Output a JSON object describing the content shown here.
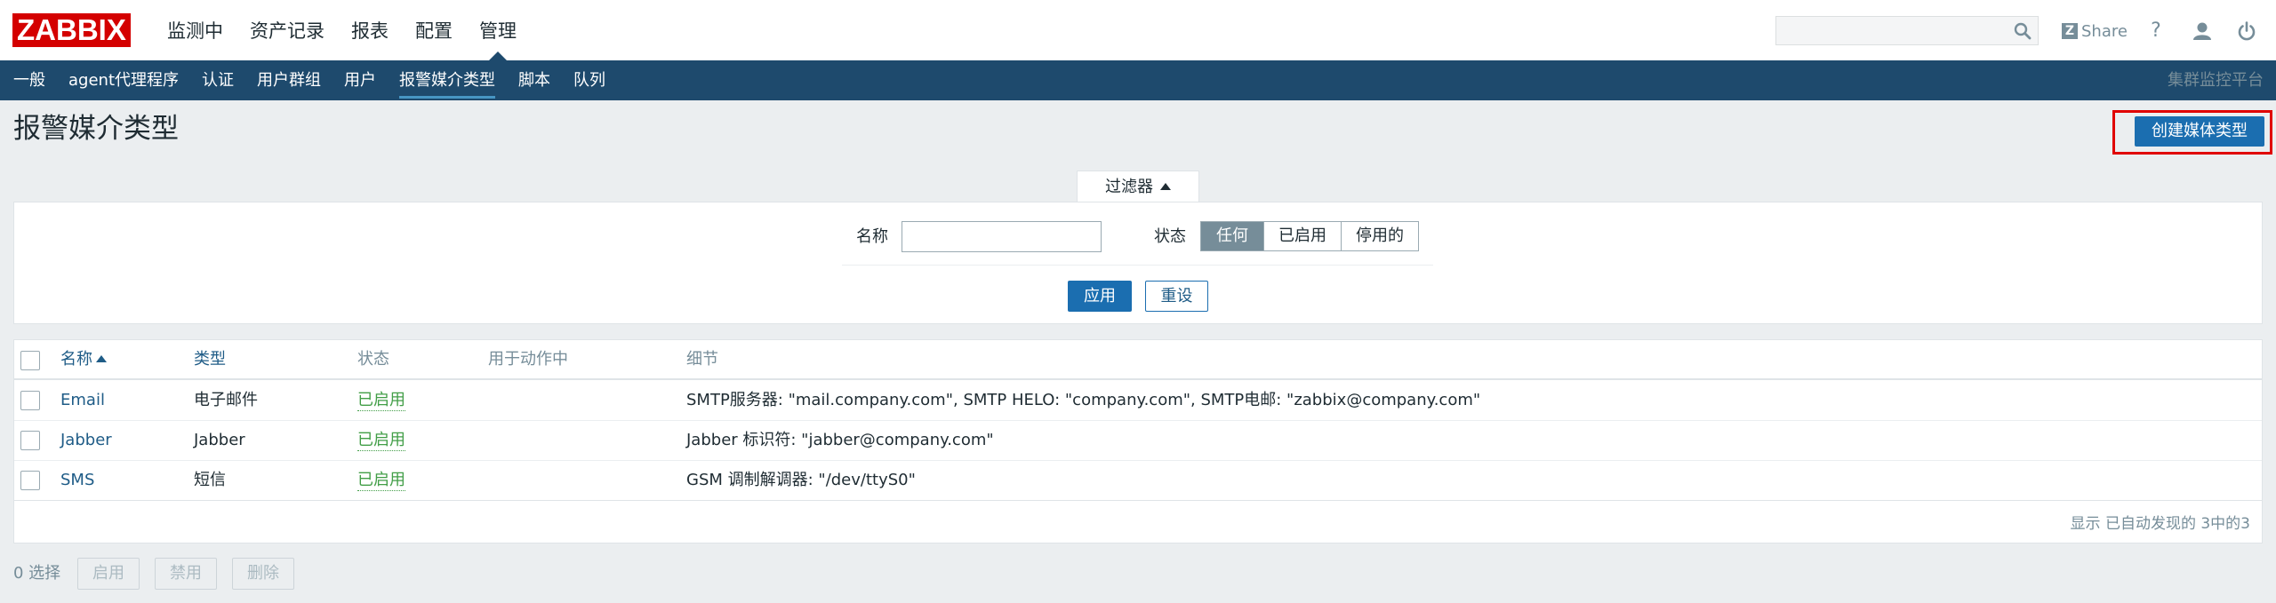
{
  "logo": {
    "text": "ZABBIX"
  },
  "main_nav": [
    {
      "label": "监测中"
    },
    {
      "label": "资产记录"
    },
    {
      "label": "报表"
    },
    {
      "label": "配置"
    },
    {
      "label": "管理",
      "selected": true
    }
  ],
  "search": {
    "placeholder": "",
    "value": ""
  },
  "share": {
    "badge": "Z",
    "label": "Share"
  },
  "top_icons": [
    "help-icon",
    "user-profile-icon",
    "sign-out-icon"
  ],
  "help": {
    "label": "?"
  },
  "sub_nav": [
    {
      "label": "一般"
    },
    {
      "label": "agent代理程序"
    },
    {
      "label": "认证"
    },
    {
      "label": "用户群组"
    },
    {
      "label": "用户"
    },
    {
      "label": "报警媒介类型",
      "selected": true
    },
    {
      "label": "脚本"
    },
    {
      "label": "队列"
    }
  ],
  "platform_label": "集群监控平台",
  "page": {
    "title": "报警媒介类型",
    "create_button": "创建媒体类型"
  },
  "filter": {
    "tab_label": "过滤器",
    "name_label": "名称",
    "name_value": "",
    "status_label": "状态",
    "status_options": [
      "任何",
      "已启用",
      "停用的"
    ],
    "status_selected": "任何",
    "apply_label": "应用",
    "reset_label": "重设"
  },
  "table": {
    "columns": [
      "名称",
      "类型",
      "状态",
      "用于动作中",
      "细节"
    ],
    "sort_column": "名称",
    "rows": [
      {
        "name": "Email",
        "type": "电子邮件",
        "status": "已启用",
        "used_in": "",
        "details": "SMTP服务器: \"mail.company.com\", SMTP HELO: \"company.com\", SMTP电邮: \"zabbix@company.com\""
      },
      {
        "name": "Jabber",
        "type": "Jabber",
        "status": "已启用",
        "used_in": "",
        "details": "Jabber 标识符: \"jabber@company.com\""
      },
      {
        "name": "SMS",
        "type": "短信",
        "status": "已启用",
        "used_in": "",
        "details": "GSM 调制解调器: \"/dev/ttyS0\""
      }
    ],
    "footer_note": "显示 已自动发现的 3中的3"
  },
  "mass_actions": {
    "selected_count": "0 选择",
    "buttons": [
      "启用",
      "禁用",
      "删除"
    ]
  },
  "colors": {
    "brand_red": "#d40000",
    "nav_blue": "#1e4a6d",
    "button_blue": "#1b6eb0",
    "link_blue": "#1f5c87",
    "enabled_green": "#429e47",
    "highlight_box": "#e00000"
  }
}
